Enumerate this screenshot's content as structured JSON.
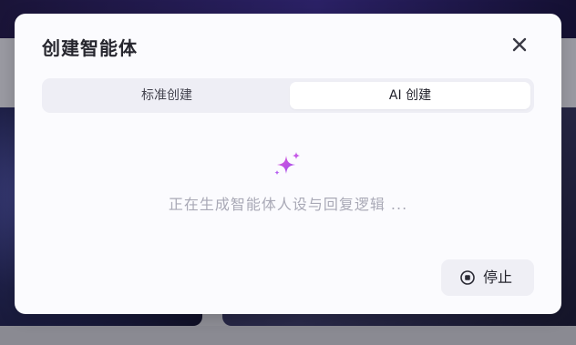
{
  "modal": {
    "title": "创建智能体",
    "close_icon": "close-icon"
  },
  "tabs": [
    {
      "label": "标准创建",
      "selected": false
    },
    {
      "label": "AI 创建",
      "selected": true
    }
  ],
  "status": {
    "icon": "sparkle-icon",
    "text": "正在生成智能体人设与回复逻辑 ..."
  },
  "stop_button": {
    "icon": "stop-circle-icon",
    "label": "停止"
  },
  "colors": {
    "accent_sparkle_start": "#c65ae8",
    "accent_sparkle_end": "#7a5cff",
    "selected_tab_bg": "#ffffff",
    "tabs_bg": "#eeeef5"
  }
}
